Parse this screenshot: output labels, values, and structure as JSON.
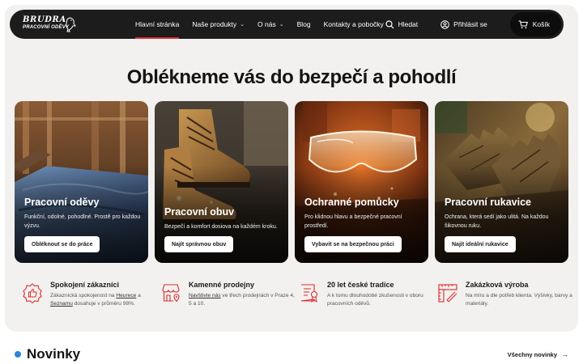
{
  "brand": {
    "line1": "BRUDRA",
    "line2": "PRACOVNÍ ODĚVY"
  },
  "nav": {
    "items": [
      {
        "label": "Hlavní stránka",
        "active": true,
        "dropdown": false
      },
      {
        "label": "Naše produkty",
        "active": false,
        "dropdown": true
      },
      {
        "label": "O nás",
        "active": false,
        "dropdown": true
      },
      {
        "label": "Blog",
        "active": false,
        "dropdown": false
      },
      {
        "label": "Kontakty a pobočky",
        "active": false,
        "dropdown": false
      }
    ],
    "search_label": "Hledat",
    "login_label": "Přihlásit se",
    "cart_label": "Košík"
  },
  "hero": {
    "headline": "Oblékneme vás do bezpečí a pohodlí"
  },
  "cards": [
    {
      "title": "Pracovní oděvy",
      "desc": "Funkční, odolné, pohodlné. Prostě pro každou výzvu.",
      "button": "Obléknout se do práce",
      "icon": "jeans-photo"
    },
    {
      "title": "Pracovní obuv",
      "desc": "Bezpečí a komfort dosiova na každém kroku.",
      "button": "Najít správnou obuv",
      "icon": "boots-photo"
    },
    {
      "title": "Ochranné pomůcky",
      "desc": "Pro klidnou hlavu a bezpečné pracovní prostředí.",
      "button": "Vybavit se na bezpečnou práci",
      "icon": "goggles-photo"
    },
    {
      "title": "Pracovní rukavice",
      "desc": "Ochrana, která sedí jako ulitá. Na každou šikovnou ruku.",
      "button": "Najít ideální rukavice",
      "icon": "gloves-photo"
    }
  ],
  "features": [
    {
      "title": "Spokojení zákazníci",
      "desc_pre": "Zákaznická spokojenost na ",
      "link1": "Heurece",
      "mid": " a ",
      "link2": "Seznamu",
      "desc_post": " dosahuje v průměru 98%.",
      "icon": "thumbs-up-icon"
    },
    {
      "title": "Kamenné prodejny",
      "desc_pre": "",
      "link1": "Navštivte nás",
      "mid": " ve třech prodejnách v Praze 4, 5 a 10.",
      "link2": "",
      "desc_post": "",
      "icon": "store-icon"
    },
    {
      "title": "20 let české tradice",
      "desc_pre": "A k tomu dlouhodobé zkušenosti v oboru pracovních oděvů.",
      "link1": "",
      "mid": "",
      "link2": "",
      "desc_post": "",
      "icon": "certificate-icon"
    },
    {
      "title": "Zakázková výroba",
      "desc_pre": "Na míru a dle potřeb klienta. Výšivky, barvy a materiály.",
      "link1": "",
      "mid": "",
      "link2": "",
      "desc_post": "",
      "icon": "ruler-icon"
    }
  ],
  "news": {
    "title": "Novinky",
    "all_label": "Všechny novinky"
  },
  "colors": {
    "accent_red": "#d82c2c",
    "nav_bg": "#1c1c1c",
    "dot_blue": "#2a86d6",
    "hero_bg": "#f3f1ef"
  }
}
